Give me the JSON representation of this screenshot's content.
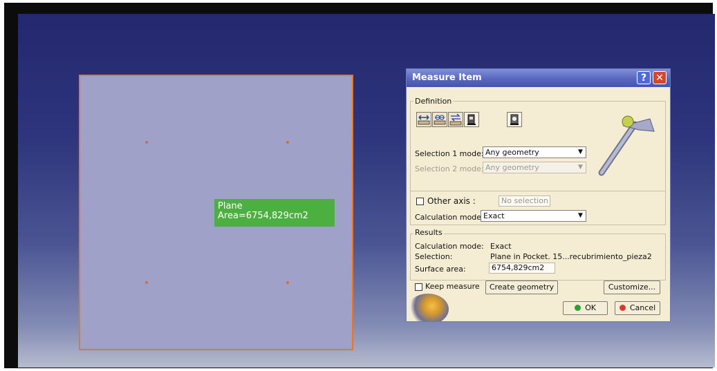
{
  "viewport": {
    "annotation": {
      "line1": "Plane",
      "line2": "Area=6754,829cm2"
    }
  },
  "dialog": {
    "title": "Measure Item",
    "help_label": "?",
    "close_label": "✕",
    "definition": {
      "group_label": "Definition",
      "tools": [
        "measure-between-icon",
        "measure-items-icon",
        "measure-thickness-icon",
        "measure-item-icon",
        "measure-inertia-icon"
      ],
      "selection1_label": "Selection 1 mode:",
      "selection1_value": "Any geometry",
      "selection2_label": "Selection 2 mode:",
      "selection2_value": "Any geometry",
      "other_axis_label": "Other axis :",
      "other_axis_placeholder": "No selection",
      "calc_mode_label": "Calculation mode:",
      "calc_mode_value": "Exact"
    },
    "results": {
      "group_label": "Results",
      "calc_mode_label": "Calculation mode:",
      "calc_mode_value": "Exact",
      "selection_label": "Selection:",
      "selection_value": "Plane in Pocket. 15...recubrimiento_pieza2",
      "surface_area_label": "Surface area:",
      "surface_area_value": "6754,829cm2"
    },
    "keep_measure_label": "Keep measure",
    "create_geometry_label": "Create geometry",
    "customize_label": "Customize...",
    "ok_label": "OK",
    "cancel_label": "Cancel"
  }
}
